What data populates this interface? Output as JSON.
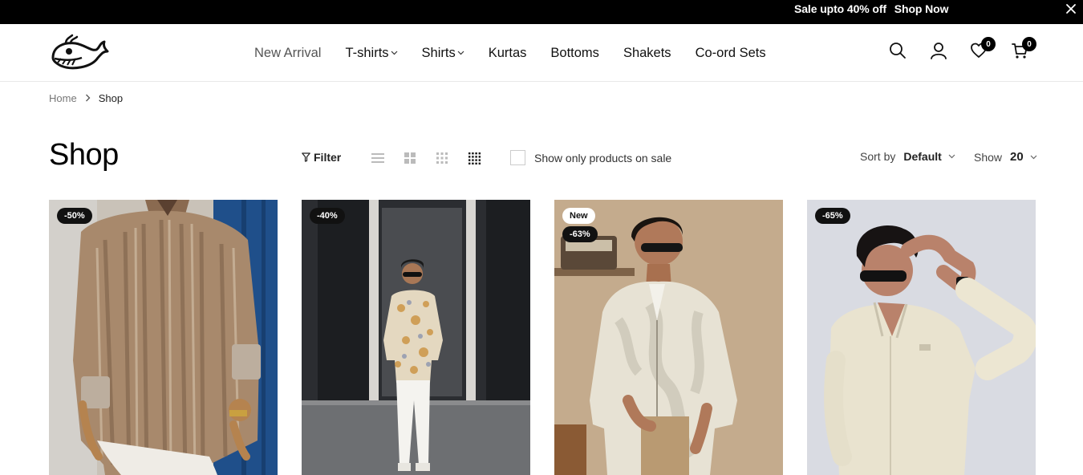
{
  "topbar": {
    "promo_text": "Sale upto 40% off",
    "promo_link": "Shop Now"
  },
  "nav": [
    {
      "label": "New Arrival",
      "dropdown": false
    },
    {
      "label": "T-shirts",
      "dropdown": true
    },
    {
      "label": "Shirts",
      "dropdown": true
    },
    {
      "label": "Kurtas",
      "dropdown": false
    },
    {
      "label": "Bottoms",
      "dropdown": false
    },
    {
      "label": "Shakets",
      "dropdown": false
    },
    {
      "label": "Co-ord Sets",
      "dropdown": false
    }
  ],
  "header": {
    "wishlist_count": "0",
    "cart_count": "0"
  },
  "breadcrumb": {
    "home": "Home",
    "current": "Shop"
  },
  "toolbar": {
    "title": "Shop",
    "filter_label": "Filter",
    "onsale_label": "Show only products on sale",
    "sort_label": "Sort by",
    "sort_value": "Default",
    "show_label": "Show",
    "show_value": "20"
  },
  "products": [
    {
      "tags": [
        "-50%"
      ]
    },
    {
      "tags": [
        "-40%"
      ]
    },
    {
      "tags": [
        "New",
        "-63%"
      ]
    },
    {
      "tags": [
        "-65%"
      ]
    }
  ],
  "colors": {
    "topbar_bg": "#000000",
    "badge_bg": "#000000",
    "text": "#111111"
  }
}
